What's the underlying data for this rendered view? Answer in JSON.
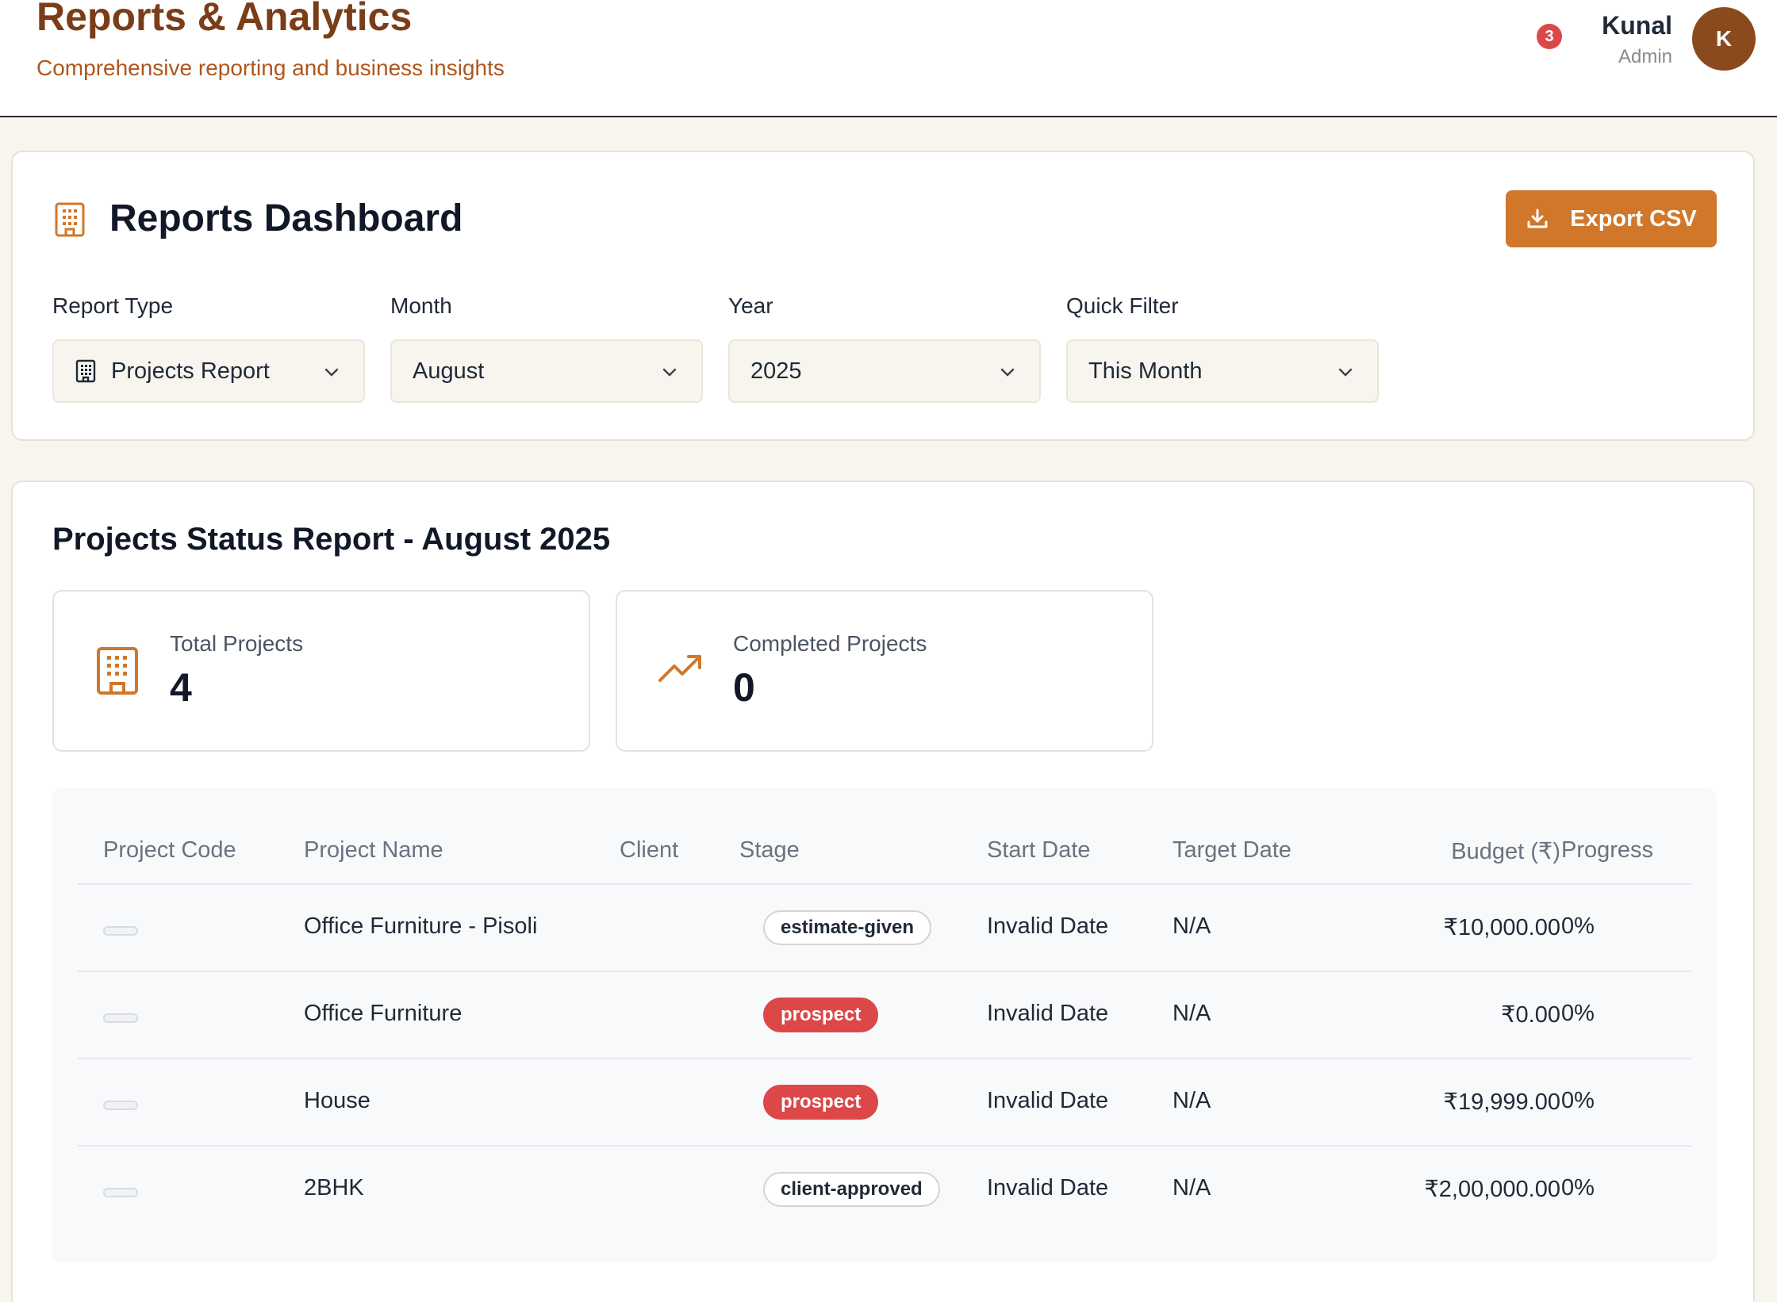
{
  "header": {
    "title": "Reports & Analytics",
    "subtitle": "Comprehensive reporting and business insights",
    "notification_count": "3",
    "user": {
      "name": "Kunal",
      "role": "Admin",
      "avatar_initial": "K"
    }
  },
  "dashboard": {
    "title": "Reports Dashboard",
    "export_label": "Export CSV",
    "filters": [
      {
        "label": "Report Type",
        "value": "Projects Report"
      },
      {
        "label": "Month",
        "value": "August"
      },
      {
        "label": "Year",
        "value": "2025"
      },
      {
        "label": "Quick Filter",
        "value": "This Month"
      }
    ]
  },
  "report": {
    "title": "Projects Status Report - August 2025",
    "stats": [
      {
        "label": "Total Projects",
        "value": "4"
      },
      {
        "label": "Completed Projects",
        "value": "0"
      }
    ],
    "columns": [
      "Project Code",
      "Project Name",
      "Client",
      "Stage",
      "Start Date",
      "Target Date",
      "Budget (₹)",
      "Progress"
    ],
    "rows": [
      {
        "code": "",
        "name": "Office Furniture - Pisoli",
        "client": "",
        "stage": "estimate-given",
        "start": "Invalid Date",
        "target": "N/A",
        "budget": "₹10,000.00",
        "progress": "0%"
      },
      {
        "code": "",
        "name": "Office Furniture",
        "client": "",
        "stage": "prospect",
        "start": "Invalid Date",
        "target": "N/A",
        "budget": "₹0.00",
        "progress": "0%"
      },
      {
        "code": "",
        "name": "House",
        "client": "",
        "stage": "prospect",
        "start": "Invalid Date",
        "target": "N/A",
        "budget": "₹19,999.00",
        "progress": "0%"
      },
      {
        "code": "",
        "name": "2BHK",
        "client": "",
        "stage": "client-approved",
        "start": "Invalid Date",
        "target": "N/A",
        "budget": "₹2,00,000.00",
        "progress": "0%"
      }
    ]
  },
  "colors": {
    "brand_dark": "#7a3d18",
    "brand_accent": "#d0772a",
    "badge_red": "#dc4848",
    "avatar": "#8a4a1e"
  },
  "icons": {
    "dashboard": "building-icon",
    "export": "download-icon",
    "select": "chevron-down-icon",
    "total": "building-icon",
    "completed": "trending-up-icon"
  }
}
